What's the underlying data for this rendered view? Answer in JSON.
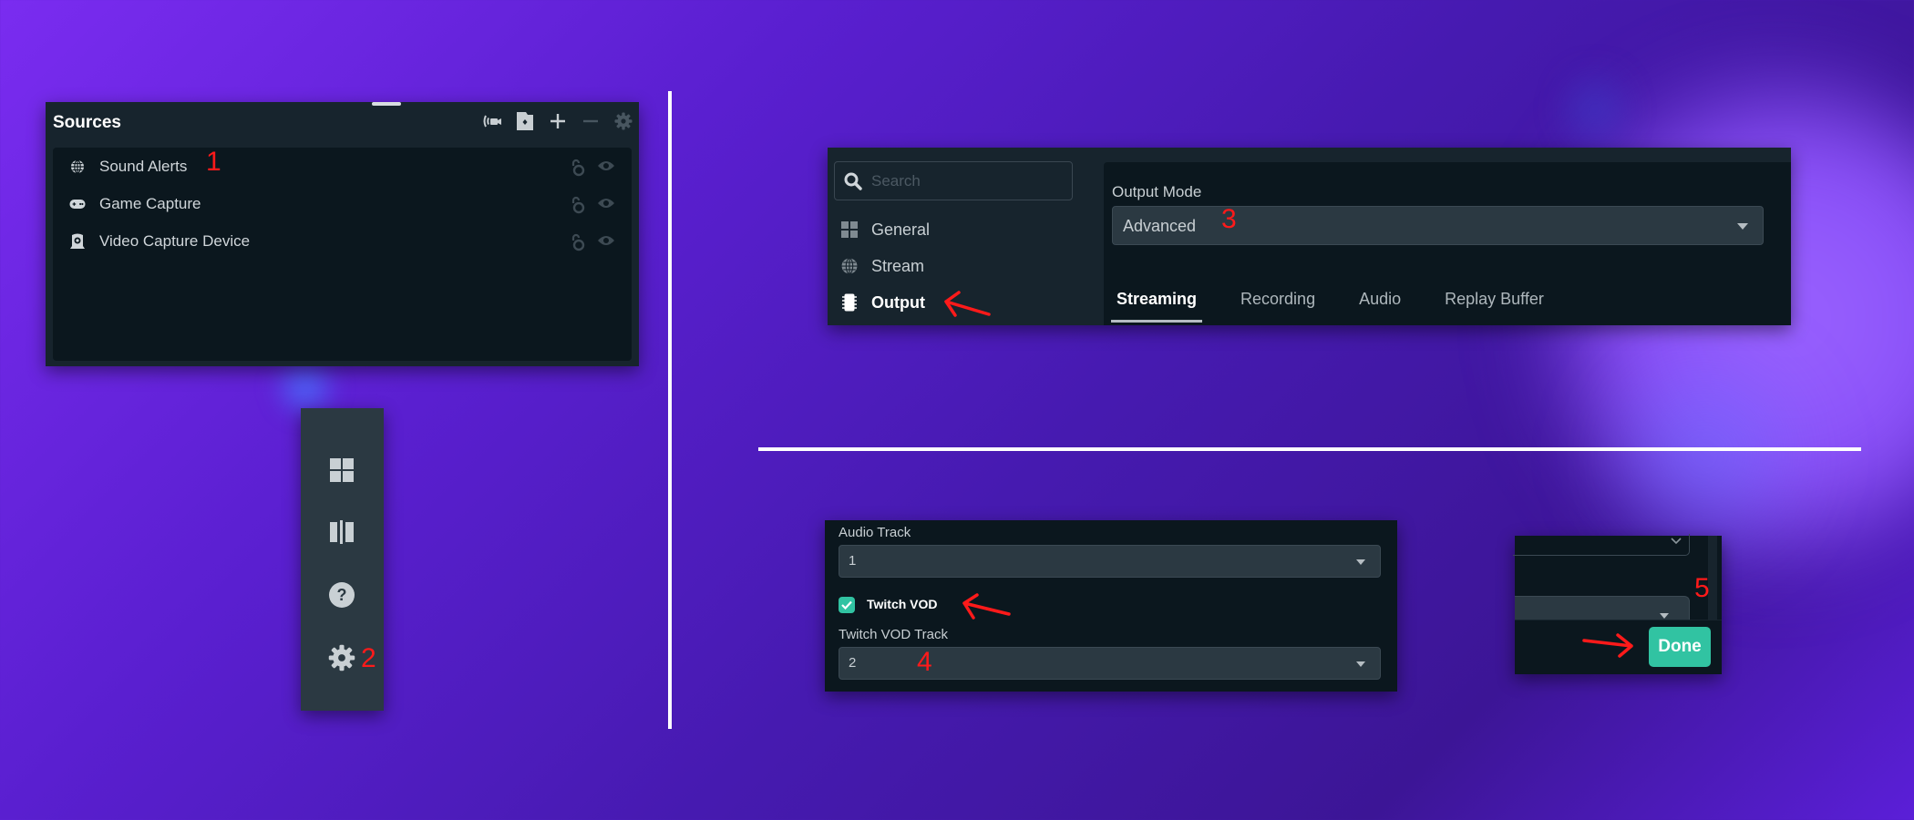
{
  "annotations": [
    "1",
    "2",
    "3",
    "4",
    "5"
  ],
  "sources_panel": {
    "title": "Sources",
    "toolbar_icons": [
      "broadcast-camera-icon",
      "folder-add-icon",
      "plus-icon",
      "minus-icon",
      "gear-icon"
    ],
    "items": [
      {
        "label": "Sound Alerts",
        "icon": "globe-icon"
      },
      {
        "label": "Game Capture",
        "icon": "gamepad-icon"
      },
      {
        "label": "Video Capture Device",
        "icon": "webcam-icon"
      }
    ]
  },
  "side_toolbar": {
    "items": [
      "layout-icon",
      "columns-icon",
      "help-icon",
      "settings-icon"
    ]
  },
  "settings": {
    "search": {
      "placeholder": "Search",
      "value": ""
    },
    "nav": [
      {
        "label": "General",
        "icon": "grid-icon"
      },
      {
        "label": "Stream",
        "icon": "globe-icon"
      },
      {
        "label": "Output",
        "icon": "chip-icon",
        "active": true
      }
    ],
    "output_mode": {
      "label": "Output Mode",
      "value": "Advanced"
    },
    "tabs": [
      {
        "label": "Streaming",
        "active": true
      },
      {
        "label": "Recording"
      },
      {
        "label": "Audio"
      },
      {
        "label": "Replay Buffer"
      }
    ]
  },
  "audio_settings": {
    "audio_track": {
      "label": "Audio Track",
      "value": "1"
    },
    "twitch_vod": {
      "label": "Twitch VOD",
      "checked": true
    },
    "twitch_vod_track": {
      "label": "Twitch VOD Track",
      "value": "2"
    }
  },
  "footer": {
    "done_label": "Done"
  },
  "colors": {
    "accent": "#31c3a2",
    "panel": "#17242d",
    "panel_dark": "#0b171e",
    "annotation": "#ff1a1a"
  }
}
